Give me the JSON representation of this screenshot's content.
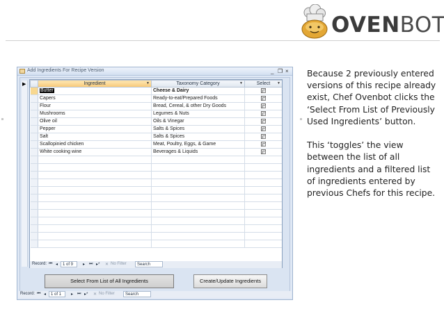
{
  "logo": {
    "brand_bold": "OVEN",
    "brand_light": "BOT",
    "icon": "chef-bot-icon"
  },
  "window": {
    "title": "Add Ingredients For Recipe Version",
    "controls": {
      "minimize": "_",
      "restore": "❐",
      "close": "×"
    }
  },
  "grid": {
    "columns": [
      {
        "key": "ingredient",
        "label": "Ingredient"
      },
      {
        "key": "category",
        "label": "Taxonomy Category"
      },
      {
        "key": "select",
        "label": "Select"
      }
    ],
    "rows": [
      {
        "ingredient": "Butter",
        "category": "Cheese & Dairy"
      },
      {
        "ingredient": "Capers",
        "category": "Ready-to-eat/Prepared Foods"
      },
      {
        "ingredient": "Flour",
        "category": "Bread, Cereal, & other Dry Goods"
      },
      {
        "ingredient": "Mushrooms",
        "category": "Legumes & Nuts"
      },
      {
        "ingredient": "Olive oil",
        "category": "Oils & Vinegar"
      },
      {
        "ingredient": "Pepper",
        "category": "Salts & Spices"
      },
      {
        "ingredient": "Salt",
        "category": "Salts & Spices"
      },
      {
        "ingredient": "Scallopinied chicken",
        "category": "Meat, Poultry, Eggs, & Game"
      },
      {
        "ingredient": "White cooking wine",
        "category": "Beverages & Liquids"
      }
    ]
  },
  "subform_nav": {
    "label": "Record:",
    "first": "⏮",
    "prev": "◂",
    "position": "1 of 9",
    "next": "▸",
    "last": "⏭",
    "new": "▸*",
    "filter": "No Filter",
    "search": "Search"
  },
  "form_nav": {
    "label": "Record:",
    "first": "⏮",
    "prev": "◂",
    "position": "1 of 1",
    "next": "▸",
    "last": "⏭",
    "new": "▸*",
    "filter": "No Filter",
    "search": "Search"
  },
  "buttons": {
    "select_all": "Select From List of All Ingredients",
    "create_update": "Create/Update Ingredients"
  },
  "description": {
    "paragraph1": "Because 2 previously entered versions of this recipe already exist, Chef Ovenbot clicks the ‘Select From List of Previously Used Ingredients’ button.",
    "paragraph2": "This ‘toggles’ the view between the list of all ingredients and a filtered list of ingredients entered by previous Chefs for this recipe."
  }
}
